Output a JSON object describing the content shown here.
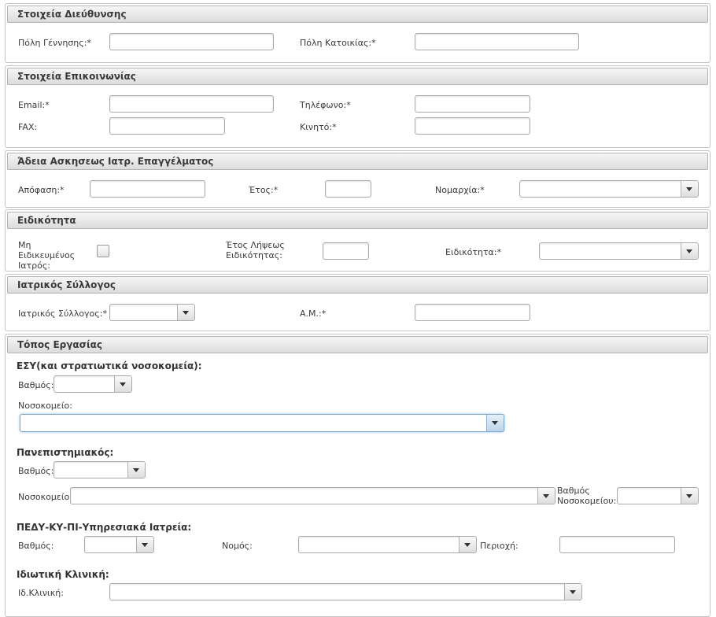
{
  "address": {
    "title": "Στοιχεία Διεύθυνσης",
    "birth_city_label": "Πόλη Γέννησης:*",
    "residence_city_label": "Πόλη Κατοικίας:*"
  },
  "contact": {
    "title": "Στοιχεία Επικοινωνίας",
    "email_label": "Email:*",
    "phone_label": "Τηλέφωνο:*",
    "fax_label": "FAX:",
    "mobile_label": "Κινητό:*"
  },
  "license": {
    "title": "Άδεια Ασκησεως Ιατρ. Επαγγέλματος",
    "decision_label": "Απόφαση:*",
    "year_label": "Έτος:*",
    "prefecture_label": "Νομαρχία:*"
  },
  "specialty": {
    "title": "Ειδικότητα",
    "non_specialized_label": "Μη Ειδικευμένος Ιατρός:",
    "year_obtained_label": "Έτος Λήψεως Ειδικότητας:",
    "specialty_label": "Ειδικότητα:*"
  },
  "association": {
    "title": "Ιατρικός Σύλλογος",
    "association_label": "Ιατρικός Σύλλογος:*",
    "am_label": "Α.Μ.:*"
  },
  "workplace": {
    "title": "Τόπος Εργασίας",
    "esy": {
      "heading": "ΕΣΥ(και στρατιωτικά νοσοκομεία):",
      "grade_label": "Βαθμός:",
      "hospital_label": "Νοσοκομείο:"
    },
    "university": {
      "heading": "Πανεπιστημιακός:",
      "grade_label": "Βαθμός:",
      "hospital_label": "Νοσοκομείο:",
      "hospital_grade_label": "Βαθμός Νοσοκομείου:"
    },
    "pedy": {
      "heading": "ΠΕΔΥ-ΚΥ-ΠΙ-Υπηρεσιακά Ιατρεία:",
      "grade_label": "Βαθμός:",
      "prefecture_label": "Νομός:",
      "area_label": "Περιοχή:"
    },
    "private": {
      "heading": "Ιδιωτική Κλινική:",
      "clinic_label": "Ιδ.Κλινική:"
    }
  }
}
